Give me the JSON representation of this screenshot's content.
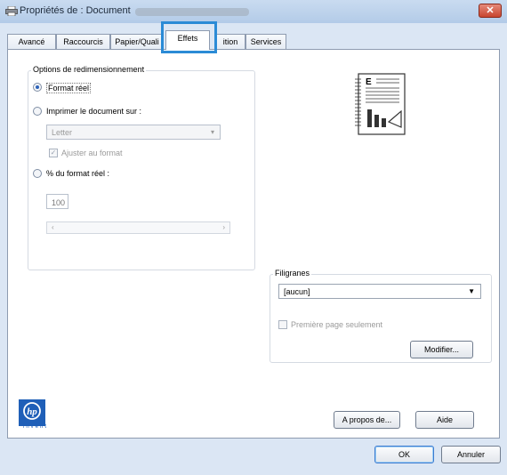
{
  "window": {
    "title": "Propriétés de : Document",
    "close_label": "✕"
  },
  "tabs": [
    {
      "label": "Avancé"
    },
    {
      "label": "Raccourcis"
    },
    {
      "label": "Papier/Quali"
    },
    {
      "label": "Effets"
    },
    {
      "label": "ition"
    },
    {
      "label": "Services"
    }
  ],
  "resize": {
    "group_label": "Options de redimensionnement",
    "actual_size_label": "Format réel",
    "print_on_label": "Imprimer le document sur :",
    "paper_select_value": "Letter",
    "fit_label": "Ajuster au format",
    "percent_label": "% du format réel :",
    "percent_value": "100",
    "slider_left": "‹",
    "slider_right": "›"
  },
  "watermark": {
    "group_label": "Filigranes",
    "select_value": "[aucun]",
    "first_page_label": "Première page seulement",
    "modify_label": "Modifier..."
  },
  "buttons": {
    "about": "A propos de...",
    "help": "Aide",
    "ok": "OK",
    "cancel": "Annuler"
  },
  "logo": {
    "text": "invent",
    "mark": "hp"
  },
  "preview": {
    "letter": "E"
  }
}
